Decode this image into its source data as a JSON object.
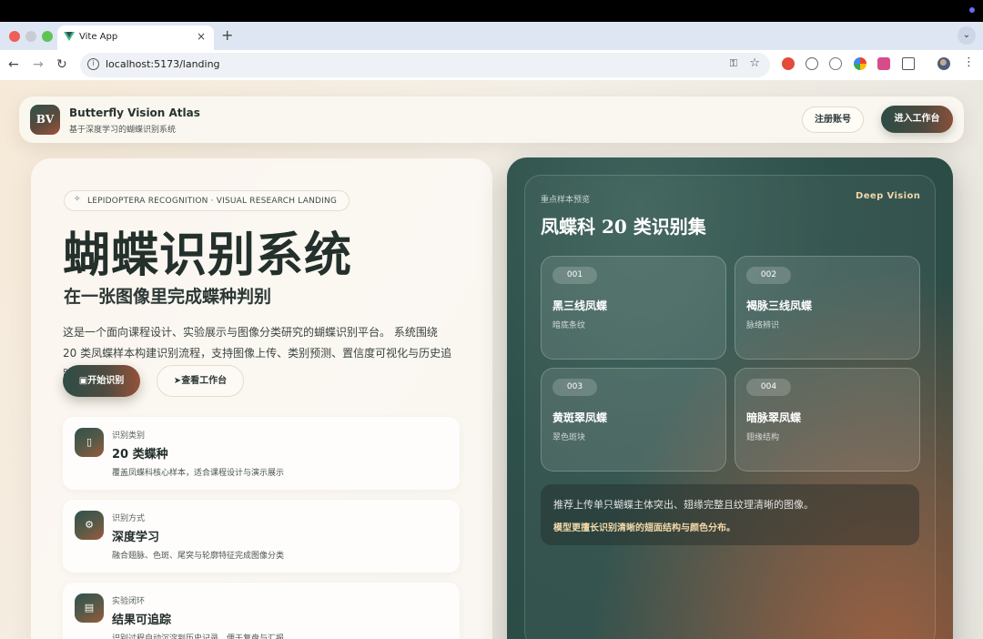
{
  "browser": {
    "tab_title": "Vite App",
    "tab_close": "×",
    "new_tab": "+",
    "url": "localhost:5173/landing"
  },
  "header": {
    "logo": "BV",
    "brand_name": "Butterfly Vision Atlas",
    "brand_sub": "基于深度学习的蝴蝶识别系统",
    "register_label": "注册账号",
    "enter_label": "进入工作台"
  },
  "hero": {
    "tag": "LEPIDOPTERA RECOGNITION · VISUAL RESEARCH LANDING",
    "title": "蝴蝶识别系统",
    "subtitle": "在一张图像里完成蝶种判别",
    "description": "这是一个面向课程设计、实验展示与图像分类研究的蝴蝶识别平台。 系统围绕 20 类凤蝶样本构建识别流程，支持图像上传、类别预测、置信度可视化与历史追踪。",
    "start_label": "开始识别",
    "view_label": "查看工作台"
  },
  "features": [
    {
      "kicker": "识别类别",
      "title": "20 类蝶种",
      "desc": "覆盖凤蝶科核心样本，适合课程设计与演示展示",
      "icon": "bookmark-icon"
    },
    {
      "kicker": "识别方式",
      "title": "深度学习",
      "desc": "融合翅脉、色斑、尾突与轮廓特征完成图像分类",
      "icon": "chip-icon"
    },
    {
      "kicker": "实验闭环",
      "title": "结果可追踪",
      "desc": "识别过程自动沉淀到历史记录，便于复盘与汇报",
      "icon": "presentation-icon"
    }
  ],
  "preview": {
    "eyebrow": "重点样本预览",
    "badge": "Deep Vision",
    "title": "凤蝶科 20 类识别集",
    "samples": [
      {
        "num": "001",
        "name": "黑三线凤蝶",
        "desc": "暗底条纹"
      },
      {
        "num": "002",
        "name": "褐脉三线凤蝶",
        "desc": "脉络辨识"
      },
      {
        "num": "003",
        "name": "黄斑翠凤蝶",
        "desc": "翠色斑块"
      },
      {
        "num": "004",
        "name": "暗脉翠凤蝶",
        "desc": "翅缘结构"
      }
    ],
    "tip_1": "推荐上传单只蝴蝶主体突出、翅缘完整且纹理清晰的图像。",
    "tip_2": "模型更擅长识别清晰的翅面结构与颜色分布。"
  }
}
